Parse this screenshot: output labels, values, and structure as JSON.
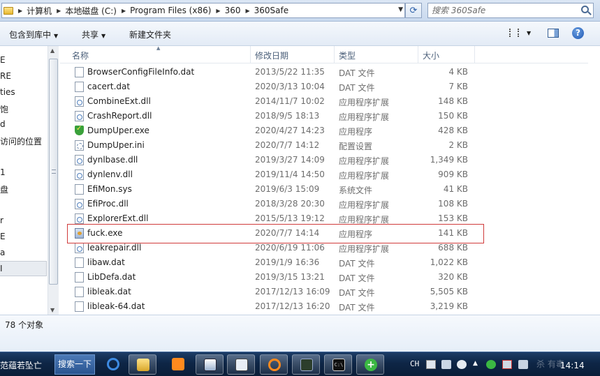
{
  "address": {
    "crumbs": [
      "计算机",
      "本地磁盘 (C:)",
      "Program Files (x86)",
      "360",
      "360Safe"
    ]
  },
  "search": {
    "placeholder": "搜索 360Safe"
  },
  "toolbar": {
    "include_label": "包含到库中",
    "share_label": "共享",
    "new_folder_label": "新建文件夹"
  },
  "nav": {
    "items": [
      "E",
      "RE",
      "ties",
      "饱",
      "d",
      "访问的位置",
      "1",
      "盘",
      "r",
      "E",
      "a",
      "I"
    ]
  },
  "columns": {
    "name": "名称",
    "date": "修改日期",
    "type": "类型",
    "size": "大小"
  },
  "files": [
    {
      "name": "BrowserConfigFileInfo.dat",
      "date": "2013/5/22 11:35",
      "type": "DAT 文件",
      "size": "4 KB",
      "icon": "file-icon"
    },
    {
      "name": "cacert.dat",
      "date": "2020/3/13 10:04",
      "type": "DAT 文件",
      "size": "7 KB",
      "icon": "file-icon"
    },
    {
      "name": "CombineExt.dll",
      "date": "2014/11/7 10:02",
      "type": "应用程序扩展",
      "size": "148 KB",
      "icon": "dll-icon"
    },
    {
      "name": "CrashReport.dll",
      "date": "2018/9/5 18:13",
      "type": "应用程序扩展",
      "size": "150 KB",
      "icon": "dll-icon"
    },
    {
      "name": "DumpUper.exe",
      "date": "2020/4/27 14:23",
      "type": "应用程序",
      "size": "428 KB",
      "icon": "shield-icon"
    },
    {
      "name": "DumpUper.ini",
      "date": "2020/7/7 14:12",
      "type": "配置设置",
      "size": "2 KB",
      "icon": "ini-icon"
    },
    {
      "name": "dynlbase.dll",
      "date": "2019/3/27 14:09",
      "type": "应用程序扩展",
      "size": "1,349 KB",
      "icon": "dll-icon"
    },
    {
      "name": "dynlenv.dll",
      "date": "2019/11/4 14:50",
      "type": "应用程序扩展",
      "size": "909 KB",
      "icon": "dll-icon"
    },
    {
      "name": "EfiMon.sys",
      "date": "2019/6/3 15:09",
      "type": "系统文件",
      "size": "41 KB",
      "icon": "sys-icon"
    },
    {
      "name": "EfiProc.dll",
      "date": "2018/3/28 20:30",
      "type": "应用程序扩展",
      "size": "108 KB",
      "icon": "dll-icon"
    },
    {
      "name": "ExplorerExt.dll",
      "date": "2015/5/13 19:12",
      "type": "应用程序扩展",
      "size": "153 KB",
      "icon": "dll-icon"
    },
    {
      "name": "fuck.exe",
      "date": "2020/7/7 14:14",
      "type": "应用程序",
      "size": "141 KB",
      "icon": "exe-icon"
    },
    {
      "name": "leakrepair.dll",
      "date": "2020/6/19 11:06",
      "type": "应用程序扩展",
      "size": "688 KB",
      "icon": "dll-icon"
    },
    {
      "name": "libaw.dat",
      "date": "2019/1/9 16:36",
      "type": "DAT 文件",
      "size": "1,022 KB",
      "icon": "file-icon"
    },
    {
      "name": "LibDefa.dat",
      "date": "2019/3/15 13:21",
      "type": "DAT 文件",
      "size": "320 KB",
      "icon": "file-icon"
    },
    {
      "name": "libleak.dat",
      "date": "2017/12/13 16:09",
      "type": "DAT 文件",
      "size": "5,505 KB",
      "icon": "file-icon"
    },
    {
      "name": "libleak-64.dat",
      "date": "2017/12/13 16:20",
      "type": "DAT 文件",
      "size": "3,219 KB",
      "icon": "file-icon"
    }
  ],
  "status": {
    "count": "78 个对象"
  },
  "taskbar": {
    "cut_label": "范蕴若坠亡",
    "search_label": "搜索一下",
    "lang": "CH",
    "clock": "14:14",
    "watermark": "杀 有毒"
  },
  "colors": {
    "highlight": "#d03b3b",
    "taskbar": "#0e2646"
  }
}
